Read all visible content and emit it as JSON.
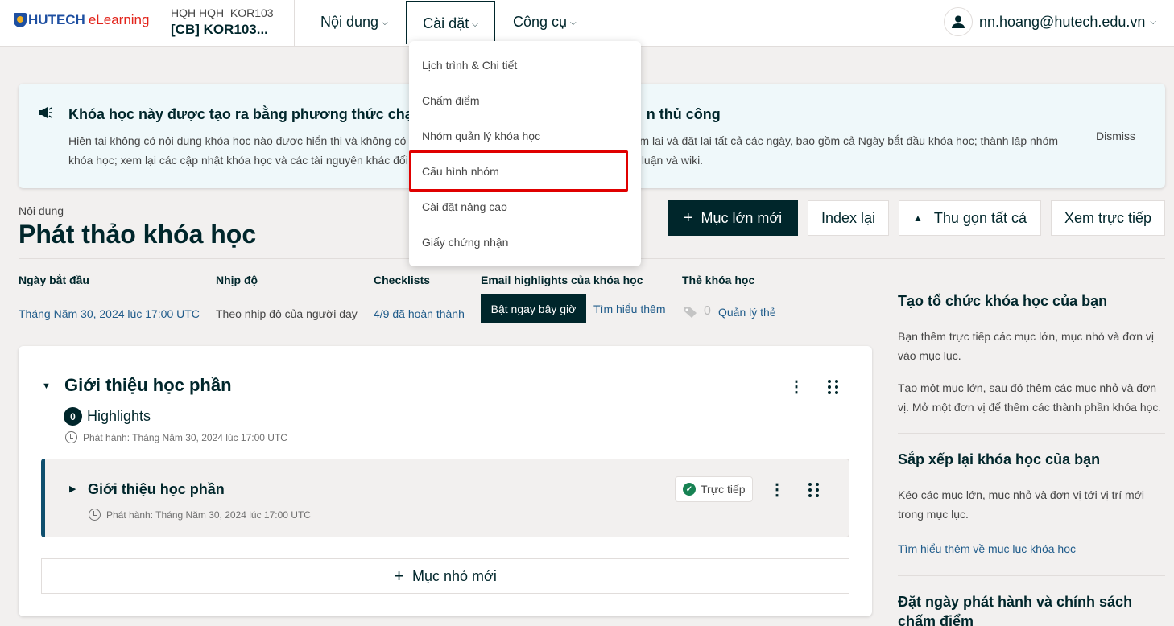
{
  "header": {
    "brand_main": "HUTECH",
    "brand_sub": "eLearning",
    "course_org": "HQH HQH_KOR103",
    "course_title": "[CB] KOR103...",
    "nav": [
      {
        "label": "Nội dung"
      },
      {
        "label": "Cài đặt"
      },
      {
        "label": "Công cụ"
      }
    ],
    "user_email": "nn.hoang@hutech.edu.vn"
  },
  "banner": {
    "title": "Khóa học này được tạo ra bằng phương thức chạy lại khóa học. Một số thiết lập cần được thay đổi thủ công",
    "title_visible_left": "Khóa học này được tạo ra bằng phương thức chạ",
    "title_visible_right": "n thủ công",
    "text_line1_left": "Hiện tại không có nội dung khóa học nào được hiển thị và không có",
    "text_line1_right": "m lại và đặt lại tất cả các ngày, bao gồm cả Ngày bắt đầu khóa học; thành lập nhóm",
    "text_line2_left": "khóa học; xem lại các cập nhật khóa học và các tài nguyên khác đối",
    "text_line2_right": "luận và wiki.",
    "dismiss": "Dismiss"
  },
  "page": {
    "breadcrumb": "Nội dung",
    "title": "Phát thảo khóa học",
    "buttons": {
      "new_section": "Mục lớn mới",
      "reindex": "Index lại",
      "collapse_all": "Thu gọn tất cả",
      "view_live": "Xem trực tiếp"
    }
  },
  "status": {
    "start_label": "Ngày bắt đầu",
    "start_value": "Tháng Năm 30, 2024 lúc 17:00 UTC",
    "pacing_label": "Nhịp độ",
    "pacing_value": "Theo nhịp độ của người dạy",
    "checklist_label": "Checklists",
    "checklist_value": "4/9 đã hoàn thành",
    "email_label": "Email highlights của khóa học",
    "email_button": "Bật ngay bây giờ",
    "email_learn": "Tìm hiểu thêm",
    "tags_label": "Thẻ khóa học",
    "tags_count": "0",
    "tags_manage": "Quản lý thẻ"
  },
  "outline": {
    "section_title": "Giới thiệu học phần",
    "highlights_count": "0",
    "highlights_label": "Highlights",
    "section_release": "Phát hành: Tháng Năm 30, 2024 lúc 17:00 UTC",
    "subsection_title": "Giới thiệu học phần",
    "subsection_status": "Trực tiếp",
    "subsection_release": "Phát hành: Tháng Năm 30, 2024 lúc 17:00 UTC",
    "new_subsection": "Mục nhỏ mới"
  },
  "sidebar": {
    "h1": "Tạo tổ chức khóa học của bạn",
    "p1": "Bạn thêm trực tiếp các mục lớn, mục nhỏ và đơn vị vào mục lục.",
    "p2": "Tạo một mục lớn, sau đó thêm các mục nhỏ và đơn vị. Mở một đơn vị để thêm các thành phần khóa học.",
    "h2": "Sắp xếp lại khóa học của bạn",
    "p3": "Kéo các mục lớn, mục nhỏ và đơn vị tới vị trí mới trong mục lục.",
    "link": "Tìm hiểu thêm về mục lục khóa học",
    "h3": "Đặt ngày phát hành và chính sách chấm điểm"
  },
  "dropdown": {
    "items": [
      {
        "label": "Lịch trình & Chi tiết"
      },
      {
        "label": "Chấm điểm"
      },
      {
        "label": "Nhóm quản lý khóa học"
      },
      {
        "label": "Cấu hình nhóm"
      },
      {
        "label": "Cài đặt nâng cao"
      },
      {
        "label": "Giấy chứng nhận"
      }
    ],
    "highlighted_index": 3
  },
  "colors": {
    "primary": "#00262b",
    "link": "#1f5b8a",
    "highlight_border": "#e00000",
    "live_green": "#178253"
  },
  "icons": [
    "megaphone-icon",
    "user-icon",
    "plus-icon",
    "caret-up-icon",
    "tag-icon",
    "kebab-icon",
    "drag-handle-icon",
    "clock-icon",
    "check-circle-icon",
    "chevron-down-icon"
  ]
}
